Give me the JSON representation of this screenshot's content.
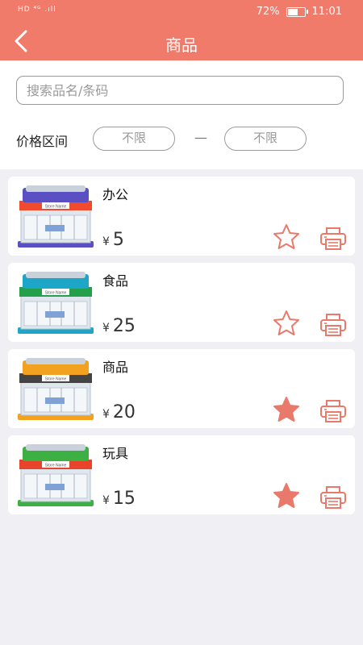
{
  "status_bar": {
    "left_indicators": "HD ⁴ᴳ .ıll",
    "battery": "72%",
    "battery_level": 0.72,
    "time": "11:01"
  },
  "header": {
    "title": "商品"
  },
  "search": {
    "placeholder": "搜索品名/条码"
  },
  "price_filter": {
    "label": "价格区间",
    "min_label": "不限",
    "separator": "—",
    "max_label": "不限"
  },
  "products": [
    {
      "name": "办公",
      "currency": "¥",
      "price": "5",
      "favorited": false,
      "store_label": "Store Name",
      "accent": "#5b4fc4",
      "awning": "#f04b2e"
    },
    {
      "name": "食品",
      "currency": "¥",
      "price": "25",
      "favorited": false,
      "store_label": "Store Name",
      "accent": "#1ea6c9",
      "awning": "#24a04a"
    },
    {
      "name": "商品",
      "currency": "¥",
      "price": "20",
      "favorited": true,
      "store_label": "Store Name",
      "accent": "#f3a21f",
      "awning": "#444444"
    },
    {
      "name": "玩具",
      "currency": "¥",
      "price": "15",
      "favorited": true,
      "store_label": "Store Name",
      "accent": "#3cb043",
      "awning": "#e8442b"
    }
  ],
  "colors": {
    "primary": "#f07b6b",
    "icon": "#e8796b"
  }
}
